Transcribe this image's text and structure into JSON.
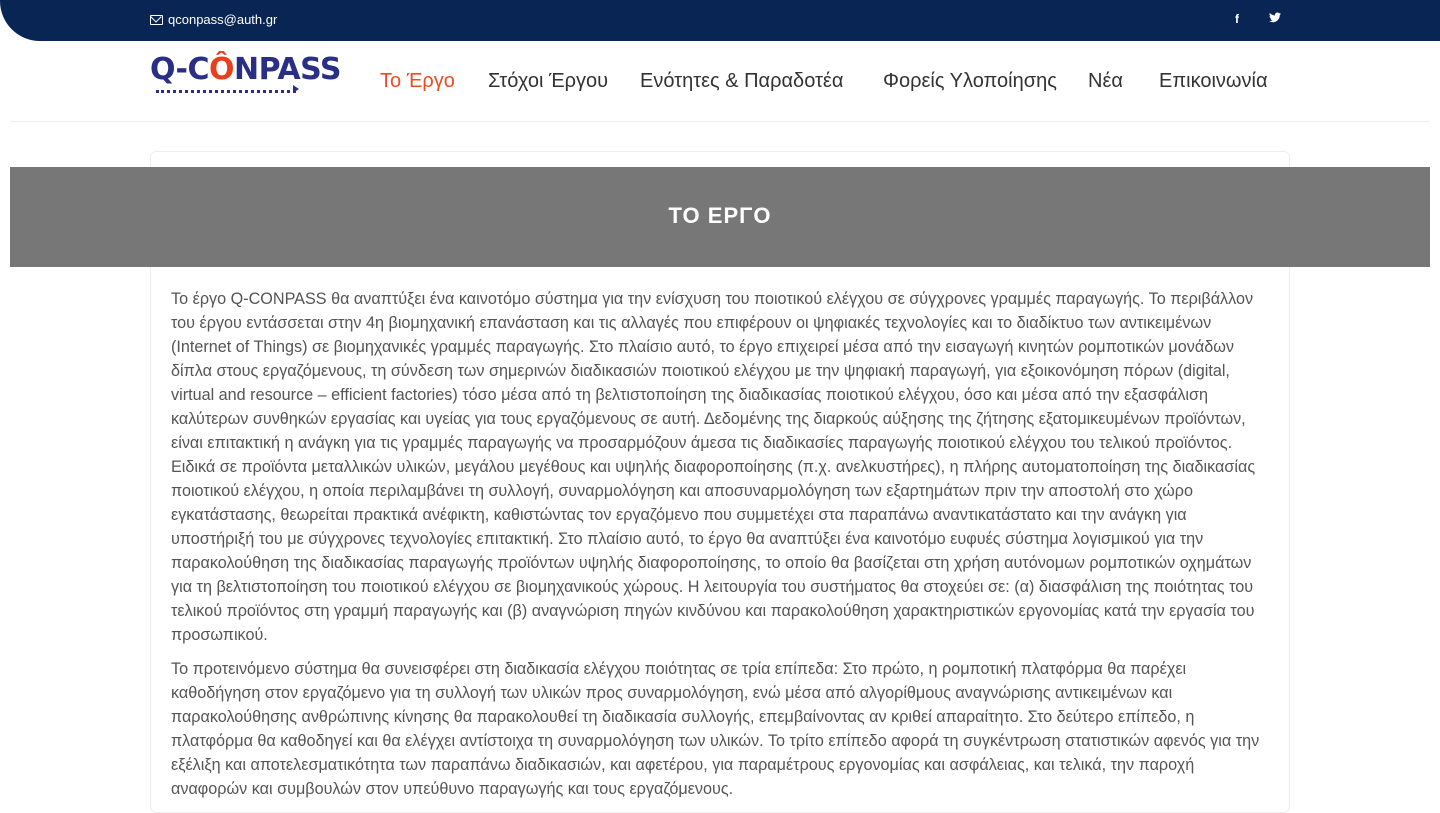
{
  "topbar": {
    "email": "qconpass@auth.gr",
    "facebook_icon": "f",
    "twitter_icon": "𝕥",
    "colors": {
      "background": "#092553"
    }
  },
  "logo": {
    "text_prefix": "Q-C",
    "text_o": "Ô",
    "text_suffix": "NPASS"
  },
  "nav": {
    "items": [
      {
        "label": "Το Έργο",
        "active": true
      },
      {
        "label": "Στόχοι Έργου"
      },
      {
        "label": "Ενότητες & Παραδοτέα"
      },
      {
        "label": "Φορείς Υλοποίησης"
      },
      {
        "label": "Νέα"
      },
      {
        "label": "Επικοινωνία"
      }
    ],
    "active_color": "#ef4a23"
  },
  "banner": {
    "title": "ΤΟ ΕΡΓΟ"
  },
  "content": {
    "paragraph1": "Το έργο Q-CONPASS θα αναπτύξει ένα καινοτόμο σύστημα για την ενίσχυση του ποιοτικού ελέγχου σε σύγχρονες γραμμές παραγωγής. Το περιβάλλον του έργου εντάσσεται στην 4η βιομηχανική επανάσταση και τις αλλαγές που επιφέρουν οι ψηφιακές τεχνολογίες και το διαδίκτυο των αντικειμένων (Internet of Things) σε βιομηχανικές γραμμές παραγωγής. Στο πλαίσιο αυτό, το έργο επιχειρεί μέσα από την εισαγωγή κινητών ρομποτικών μονάδων δίπλα στους εργαζόμενους, τη σύνδεση των σημερινών διαδικασιών ποιοτικού ελέγχου με την ψηφιακή παραγωγή, για εξοικονόμηση πόρων (digital, virtual and resource – efficient factories) τόσο μέσα από τη βελτιστοποίηση της διαδικασίας ποιοτικού ελέγχου, όσο και μέσα από την εξασφάλιση καλύτερων συνθηκών εργασίας και υγείας για τους εργαζόμενους σε αυτή. Δεδομένης της διαρκούς αύξησης της ζήτησης εξατομικευμένων προϊόντων, είναι επιτακτική η ανάγκη για τις γραμμές παραγωγής να προσαρμόζουν άμεσα τις διαδικασίες παραγωγής ποιοτικού ελέγχου του τελικού προϊόντος. Ειδικά σε προϊόντα μεταλλικών υλικών, μεγάλου μεγέθους και υψηλής διαφοροποίησης (π.χ. ανελκυστήρες), η πλήρης αυτοματοποίηση της διαδικασίας ποιοτικού ελέγχου, η οποία περιλαμβάνει τη συλλογή, συναρμολόγηση και αποσυναρμολόγηση των εξαρτημάτων πριν την αποστολή στο χώρο εγκατάστασης, θεωρείται πρακτικά ανέφικτη, καθιστώντας τον εργαζόμενο που συμμετέχει στα παραπάνω αναντικατάστατο και την ανάγκη για υποστήριξή του με σύγχρονες τεχνολογίες επιτακτική. Στο πλαίσιο αυτό, το έργο θα αναπτύξει ένα καινοτόμο ευφυές σύστημα λογισμικού για την παρακολούθηση της διαδικασίας παραγωγής προϊόντων υψηλής διαφοροποίησης, το οποίο θα βασίζεται στη χρήση αυτόνομων ρομποτικών οχημάτων για τη βελτιστοποίηση του ποιοτικού ελέγχου σε βιομηχανικούς χώρους. Η λειτουργία του συστήματος θα στοχεύει σε: (α) διασφάλιση της ποιότητας του τελικού προϊόντος στη γραμμή παραγωγής και (β) αναγνώριση πηγών κινδύνου και παρακολούθηση χαρακτηριστικών εργονομίας κατά την εργασία του προσωπικού.",
    "paragraph2": "Το προτεινόμενο σύστημα θα συνεισφέρει στη διαδικασία ελέγχου ποιότητας σε τρία επίπεδα: Στο πρώτο, η ρομποτική πλατφόρμα θα παρέχει καθοδήγηση στον εργαζόμενο για τη συλλογή των υλικών προς συναρμολόγηση, ενώ μέσα από αλγορίθμους αναγνώρισης αντικειμένων και παρακολούθησης ανθρώπινης κίνησης θα παρακολουθεί τη διαδικασία συλλογής, επεμβαίνοντας αν κριθεί απαραίτητο. Στο δεύτερο επίπεδο, η πλατφόρμα θα καθοδηγεί και θα ελέγχει αντίστοιχα τη συναρμολόγηση των υλικών. Το τρίτο επίπεδο αφορά τη συγκέντρωση στατιστικών αφενός για την εξέλιξη και αποτελεσματικότητα των παραπάνω διαδικασιών, και αφετέρου, για παραμέτρους εργονομίας και ασφάλειας, και τελικά, την παροχή αναφορών και συμβουλών στον υπεύθυνο παραγωγής και τους εργαζόμενους."
  }
}
